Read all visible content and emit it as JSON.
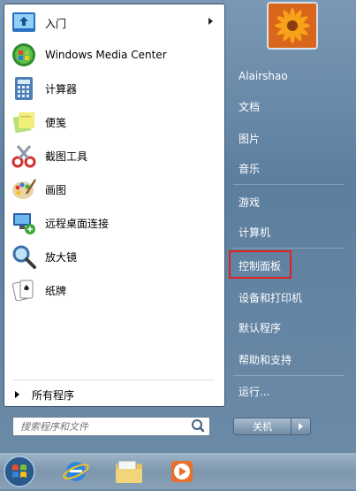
{
  "left_pane": {
    "items": [
      {
        "label": "入门",
        "icon": "getting-started-icon",
        "has_submenu": true
      },
      {
        "label": "Windows Media Center",
        "icon": "windows-media-center-icon"
      },
      {
        "label": "计算器",
        "icon": "calculator-icon"
      },
      {
        "label": "便笺",
        "icon": "sticky-notes-icon"
      },
      {
        "label": "截图工具",
        "icon": "snipping-tool-icon"
      },
      {
        "label": "画图",
        "icon": "paint-icon"
      },
      {
        "label": "远程桌面连接",
        "icon": "remote-desktop-icon"
      },
      {
        "label": "放大镜",
        "icon": "magnifier-icon"
      },
      {
        "label": "纸牌",
        "icon": "solitaire-icon"
      }
    ],
    "all_programs": "所有程序",
    "search_placeholder": "搜索程序和文件"
  },
  "right_pane": {
    "user_name": "Alairshao",
    "items": [
      "文档",
      "图片",
      "音乐",
      "游戏",
      "计算机",
      "控制面板",
      "设备和打印机",
      "默认程序",
      "帮助和支持",
      "运行..."
    ],
    "highlighted": "控制面板",
    "shutdown_label": "关机"
  },
  "taskbar": {
    "buttons": [
      "start-orb",
      "internet-explorer-icon",
      "file-explorer-icon",
      "media-player-icon"
    ]
  },
  "colors": {
    "highlight_border": "#e02020"
  }
}
